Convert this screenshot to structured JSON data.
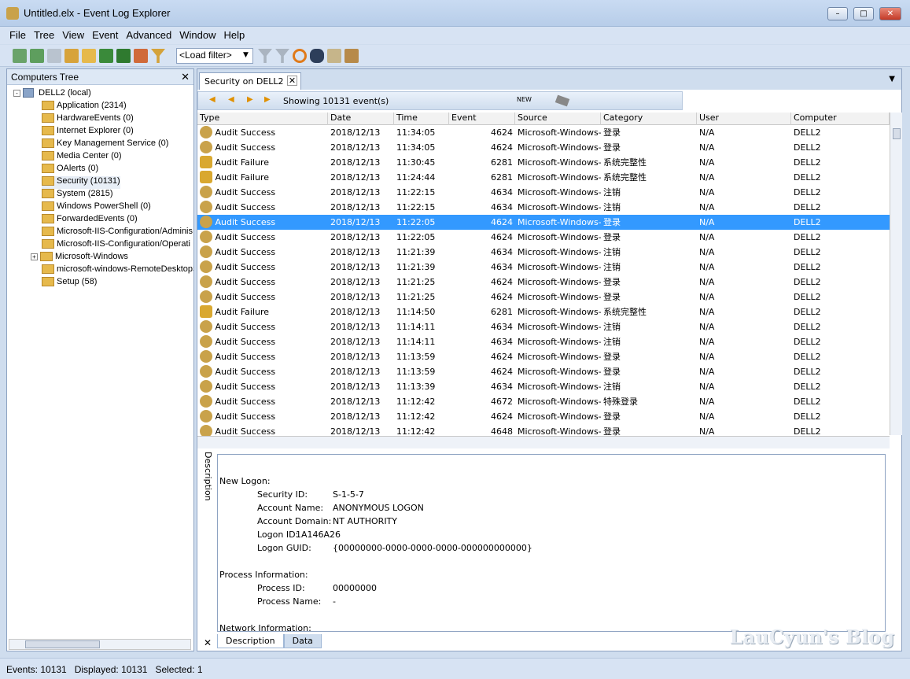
{
  "window": {
    "title": "Untitled.elx - Event Log Explorer"
  },
  "menu": [
    "File",
    "Tree",
    "View",
    "Event",
    "Advanced",
    "Window",
    "Help"
  ],
  "toolbar": {
    "filter_placeholder": "<Load filter>"
  },
  "tree": {
    "title": "Computers Tree",
    "root": "DELL2 (local)",
    "items": [
      "Application (2314)",
      "HardwareEvents (0)",
      "Internet Explorer (0)",
      "Key Management Service (0)",
      "Media Center (0)",
      "OAlerts (0)",
      "Security (10131)",
      "System (2815)",
      "Windows PowerShell (0)",
      "ForwardedEvents (0)",
      "Microsoft-IIS-Configuration/Adminis",
      "Microsoft-IIS-Configuration/Operati",
      "Microsoft-Windows",
      "microsoft-windows-RemoteDesktopS",
      "Setup (58)"
    ]
  },
  "tab": {
    "label": "Security on DELL2"
  },
  "grid": {
    "showing": "Showing 10131 event(s)",
    "new_label": "NEW",
    "columns": [
      "Type",
      "Date",
      "Time",
      "Event",
      "Source",
      "Category",
      "User",
      "Computer"
    ],
    "rows": [
      [
        "Audit Success",
        "2018/12/13",
        "11:34:05",
        "4624",
        "Microsoft-Windows-Se",
        "登录",
        "N/A",
        "DELL2"
      ],
      [
        "Audit Success",
        "2018/12/13",
        "11:34:05",
        "4624",
        "Microsoft-Windows-Se",
        "登录",
        "N/A",
        "DELL2"
      ],
      [
        "Audit Failure",
        "2018/12/13",
        "11:30:45",
        "6281",
        "Microsoft-Windows-Se",
        "系统完整性",
        "N/A",
        "DELL2"
      ],
      [
        "Audit Failure",
        "2018/12/13",
        "11:24:44",
        "6281",
        "Microsoft-Windows-Se",
        "系统完整性",
        "N/A",
        "DELL2"
      ],
      [
        "Audit Success",
        "2018/12/13",
        "11:22:15",
        "4634",
        "Microsoft-Windows-Se",
        "注销",
        "N/A",
        "DELL2"
      ],
      [
        "Audit Success",
        "2018/12/13",
        "11:22:15",
        "4634",
        "Microsoft-Windows-Se",
        "注销",
        "N/A",
        "DELL2"
      ],
      [
        "Audit Success",
        "2018/12/13",
        "11:22:05",
        "4624",
        "Microsoft-Windows-Se",
        "登录",
        "N/A",
        "DELL2"
      ],
      [
        "Audit Success",
        "2018/12/13",
        "11:22:05",
        "4624",
        "Microsoft-Windows-Se",
        "登录",
        "N/A",
        "DELL2"
      ],
      [
        "Audit Success",
        "2018/12/13",
        "11:21:39",
        "4634",
        "Microsoft-Windows-Se",
        "注销",
        "N/A",
        "DELL2"
      ],
      [
        "Audit Success",
        "2018/12/13",
        "11:21:39",
        "4634",
        "Microsoft-Windows-Se",
        "注销",
        "N/A",
        "DELL2"
      ],
      [
        "Audit Success",
        "2018/12/13",
        "11:21:25",
        "4624",
        "Microsoft-Windows-Se",
        "登录",
        "N/A",
        "DELL2"
      ],
      [
        "Audit Success",
        "2018/12/13",
        "11:21:25",
        "4624",
        "Microsoft-Windows-Se",
        "登录",
        "N/A",
        "DELL2"
      ],
      [
        "Audit Failure",
        "2018/12/13",
        "11:14:50",
        "6281",
        "Microsoft-Windows-Se",
        "系统完整性",
        "N/A",
        "DELL2"
      ],
      [
        "Audit Success",
        "2018/12/13",
        "11:14:11",
        "4634",
        "Microsoft-Windows-Se",
        "注销",
        "N/A",
        "DELL2"
      ],
      [
        "Audit Success",
        "2018/12/13",
        "11:14:11",
        "4634",
        "Microsoft-Windows-Se",
        "注销",
        "N/A",
        "DELL2"
      ],
      [
        "Audit Success",
        "2018/12/13",
        "11:13:59",
        "4624",
        "Microsoft-Windows-Se",
        "登录",
        "N/A",
        "DELL2"
      ],
      [
        "Audit Success",
        "2018/12/13",
        "11:13:59",
        "4624",
        "Microsoft-Windows-Se",
        "登录",
        "N/A",
        "DELL2"
      ],
      [
        "Audit Success",
        "2018/12/13",
        "11:13:39",
        "4634",
        "Microsoft-Windows-Se",
        "注销",
        "N/A",
        "DELL2"
      ],
      [
        "Audit Success",
        "2018/12/13",
        "11:12:42",
        "4672",
        "Microsoft-Windows-Se",
        "特殊登录",
        "N/A",
        "DELL2"
      ],
      [
        "Audit Success",
        "2018/12/13",
        "11:12:42",
        "4624",
        "Microsoft-Windows-Se",
        "登录",
        "N/A",
        "DELL2"
      ],
      [
        "Audit Success",
        "2018/12/13",
        "11:12:42",
        "4648",
        "Microsoft-Windows-Se",
        "登录",
        "N/A",
        "DELL2"
      ]
    ],
    "selected_row": 6
  },
  "description": {
    "vtab": "Description",
    "lines": [
      {
        "section": "New Logon:"
      },
      {
        "k": "Security ID:",
        "v": "S-1-5-7"
      },
      {
        "k": "Account Name:",
        "v": "ANONYMOUS LOGON"
      },
      {
        "k": "Account Domain:",
        "v": "NT AUTHORITY"
      },
      {
        "k": "Logon ID:",
        "v": "1A146A26",
        "short": true
      },
      {
        "k": "Logon GUID:",
        "v": "{00000000-0000-0000-0000-000000000000}"
      },
      {
        "section": ""
      },
      {
        "section": "Process Information:"
      },
      {
        "k": "Process ID:",
        "v": "00000000"
      },
      {
        "k": "Process Name:",
        "v": "-"
      },
      {
        "section": ""
      },
      {
        "section": "Network Information:"
      }
    ],
    "tabs": [
      "Description",
      "Data"
    ]
  },
  "status": {
    "text": "Events: 10131   Displayed: 10131   Selected: 1"
  },
  "watermark": "LauCyun's Blog"
}
